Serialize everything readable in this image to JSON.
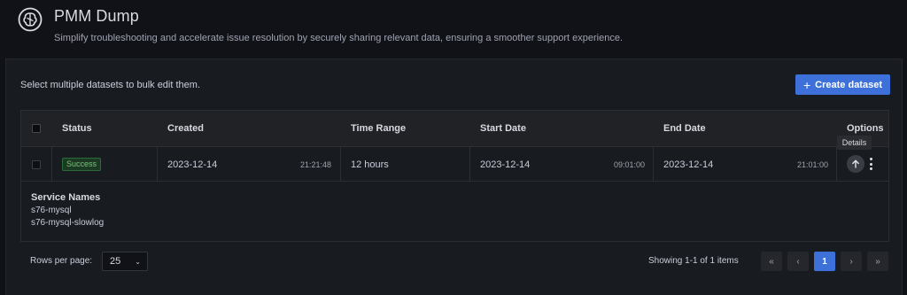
{
  "header": {
    "title": "PMM Dump",
    "subtitle": "Simplify troubleshooting and accelerate issue resolution by securely sharing relevant data, ensuring a smoother support experience."
  },
  "toolbar": {
    "hint": "Select multiple datasets to bulk edit them.",
    "create_label": "Create dataset"
  },
  "table": {
    "columns": [
      "Status",
      "Created",
      "Time Range",
      "Start Date",
      "End Date",
      "Options"
    ],
    "rows": [
      {
        "status": "Success",
        "created_date": "2023-12-14",
        "created_time": "21:21:48",
        "time_range": "12 hours",
        "start_date": "2023-12-14",
        "start_time": "09:01:00",
        "end_date": "2023-12-14",
        "end_time": "21:01:00",
        "tooltip": "Details",
        "details": {
          "title": "Service Names",
          "services": [
            "s76-mysql",
            "s76-mysql-slowlog"
          ]
        }
      }
    ]
  },
  "pagination": {
    "rows_per_page_label": "Rows per page:",
    "rows_per_page_value": "25",
    "showing": "Showing 1-1 of 1 items",
    "first": "«",
    "prev": "‹",
    "current": "1",
    "next": "›",
    "last": "»"
  },
  "icons": {
    "logo": "brain-icon",
    "expand": "arrow-up-icon",
    "options": "kebab-menu-icon",
    "select": "chevron-down-icon"
  },
  "colors": {
    "accent": "#3d71d9",
    "success": "#7fbf7f",
    "background": "#111217",
    "panel": "#181b1f"
  }
}
